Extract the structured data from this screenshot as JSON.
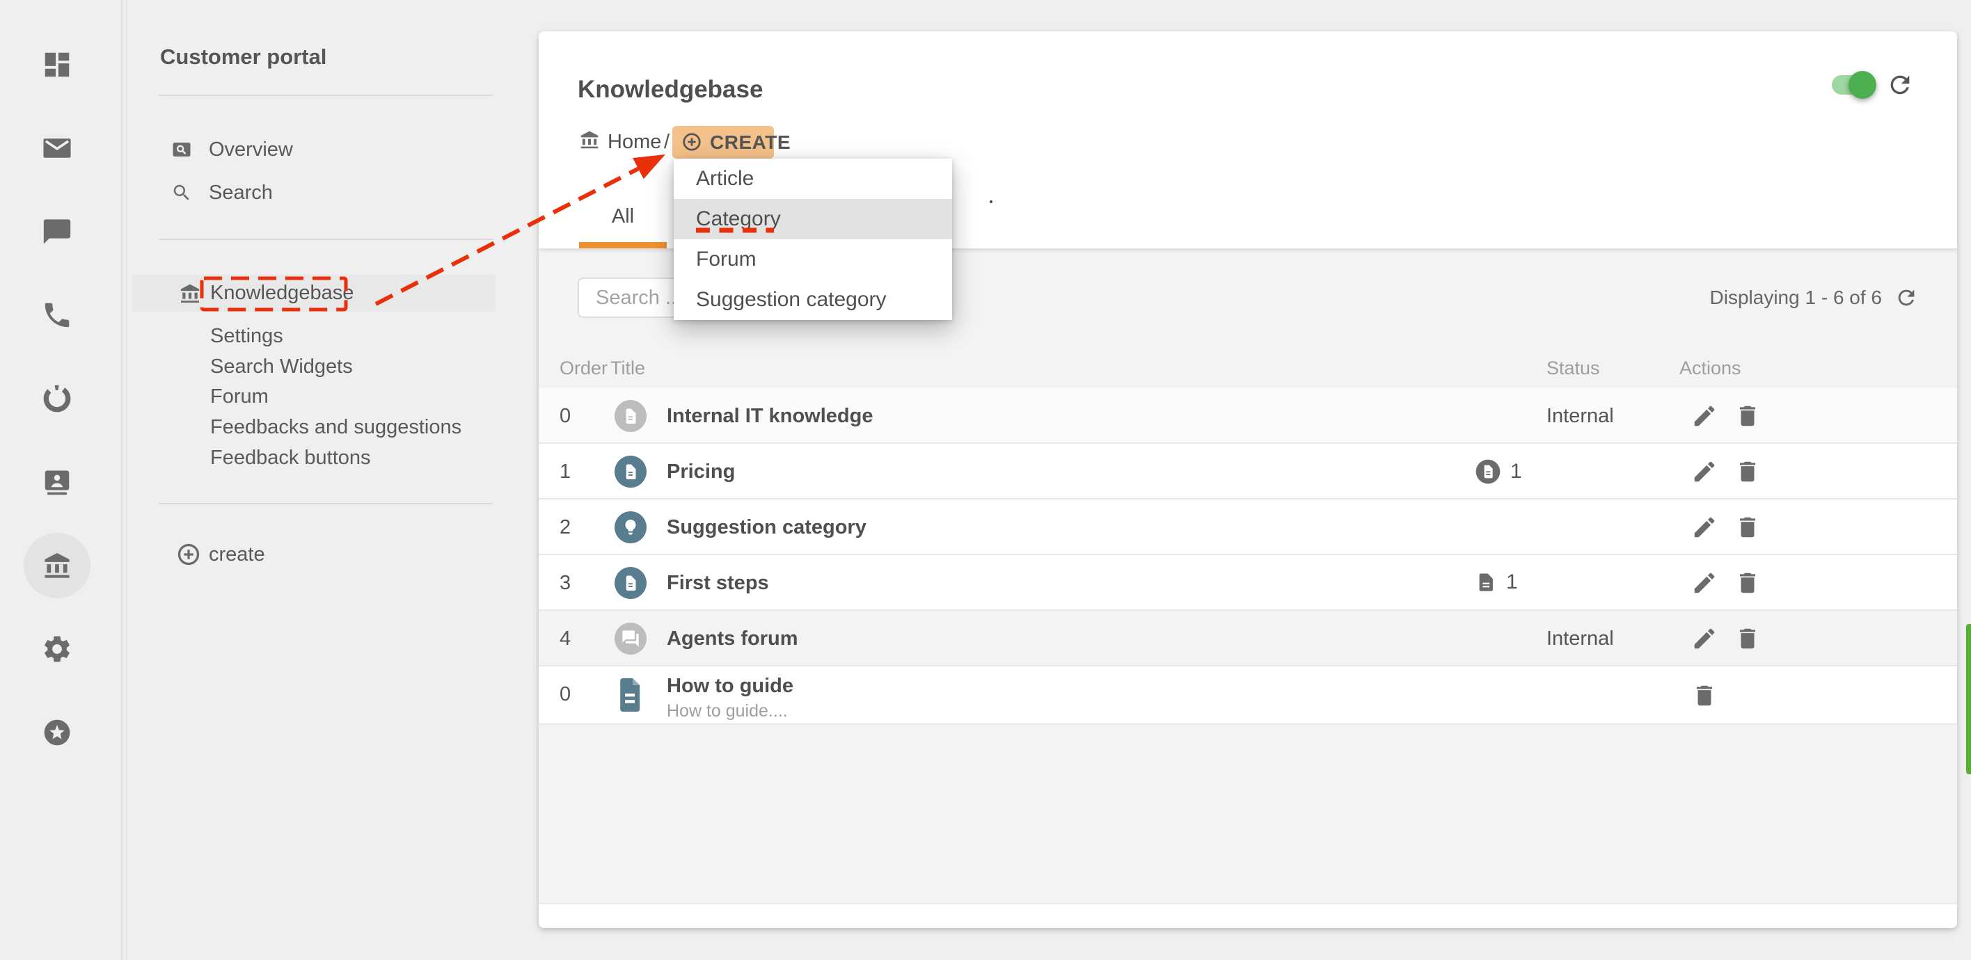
{
  "rail": {
    "icons": [
      "dashboard",
      "mail",
      "chat",
      "phone",
      "sync",
      "contacts",
      "knowledgebase",
      "settings",
      "rewards"
    ],
    "active": "knowledgebase"
  },
  "sidebar": {
    "title": "Customer portal",
    "overview": "Overview",
    "search": "Search",
    "knowledgebase": "Knowledgebase",
    "sub": [
      "Settings",
      "Search Widgets",
      "Forum",
      "Feedbacks and suggestions",
      "Feedback buttons"
    ],
    "create": "create"
  },
  "header": {
    "title": "Knowledgebase",
    "breadcrumb_home": "Home",
    "breadcrumb_sep": "/",
    "create_button": "CREATE"
  },
  "tabs": {
    "all": "All"
  },
  "menu": {
    "items": [
      "Article",
      "Category",
      "Forum",
      "Suggestion category"
    ],
    "highlighted": "Category"
  },
  "toolbar": {
    "search_placeholder": "Search ...",
    "displaying": "Displaying 1 - 6 of 6"
  },
  "table": {
    "headers": {
      "order": "Order",
      "title": "Title",
      "status": "Status",
      "actions": "Actions"
    },
    "rows": [
      {
        "order": "0",
        "title": "Internal IT knowledge",
        "status": "Internal"
      },
      {
        "order": "1",
        "title": "Pricing",
        "badge_count": "1"
      },
      {
        "order": "2",
        "title": "Suggestion category"
      },
      {
        "order": "3",
        "title": "First steps",
        "badge_count": "1"
      },
      {
        "order": "4",
        "title": "Agents forum",
        "status": "Internal"
      },
      {
        "order": "0",
        "title": "How to guide",
        "subtitle": "How to guide...."
      }
    ]
  },
  "colors": {
    "accent_orange": "#f0912f",
    "create_button_bg": "#f5c18a",
    "annotation_red": "#ea2f0b",
    "toggle_green": "#4caf50",
    "green_bar": "#55b231",
    "avatar_teal": "#587d8e",
    "avatar_grey": "#bdbdbd"
  }
}
